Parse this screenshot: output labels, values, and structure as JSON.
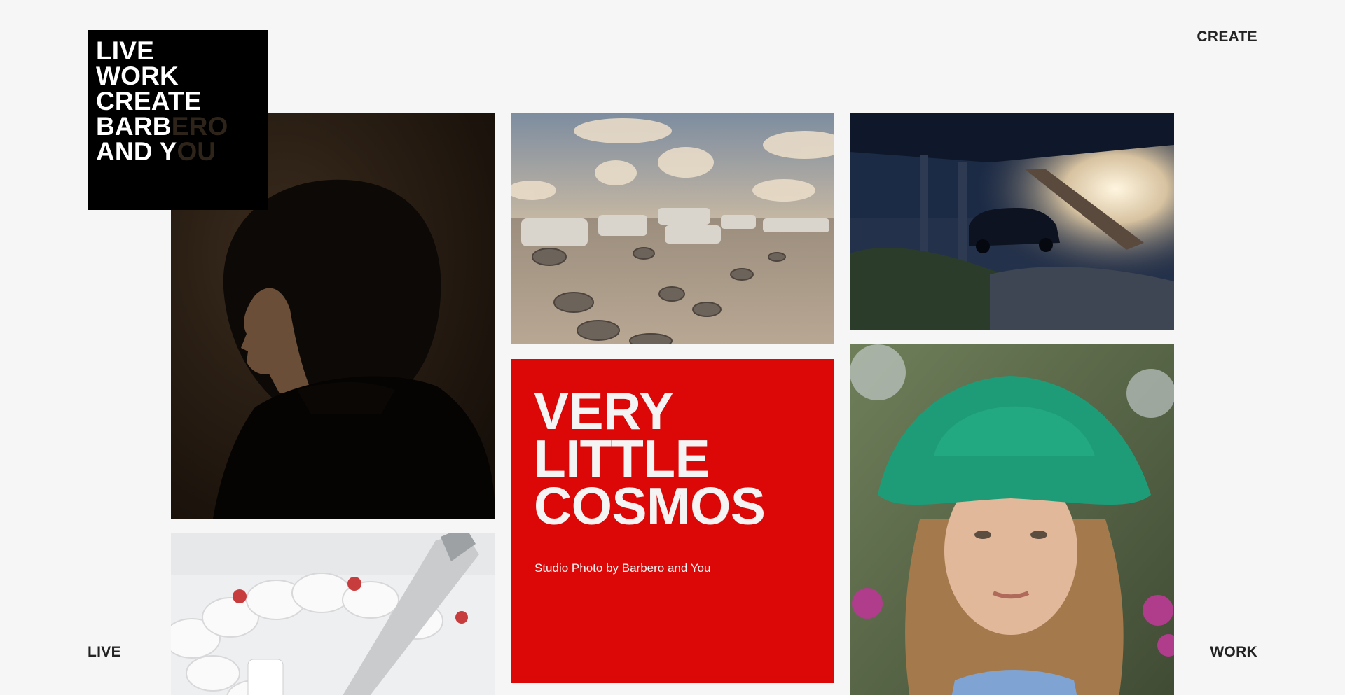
{
  "logo": {
    "lines": [
      "LIVE",
      "WORK",
      "CREATE",
      "BARBERO",
      "AND YOU"
    ],
    "barbero_visible": "BARB",
    "barbero_hidden": "ERO",
    "andyou_visible": "AND Y",
    "andyou_hidden": "OU"
  },
  "nav": {
    "create": "CREATE",
    "live": "LIVE",
    "work": "WORK"
  },
  "feature": {
    "title_lines": [
      "VERY",
      "LITTLE",
      "COSMOS"
    ],
    "subtitle": "Studio Photo by Barbero and You",
    "background_color": "#dc0808"
  },
  "tiles": [
    {
      "name": "portrait-photo",
      "subject": "profile portrait of a woman in dark tones"
    },
    {
      "name": "junkyard-photo",
      "subject": "car junkyard with tires under a cloudy sky"
    },
    {
      "name": "car-photo",
      "subject": "dark car parked under a modern building at sunset"
    },
    {
      "name": "cake-photo",
      "subject": "cream cake with cherries and a knife"
    },
    {
      "name": "girl-photo",
      "subject": "girl wearing a green knitted bucket hat"
    }
  ]
}
